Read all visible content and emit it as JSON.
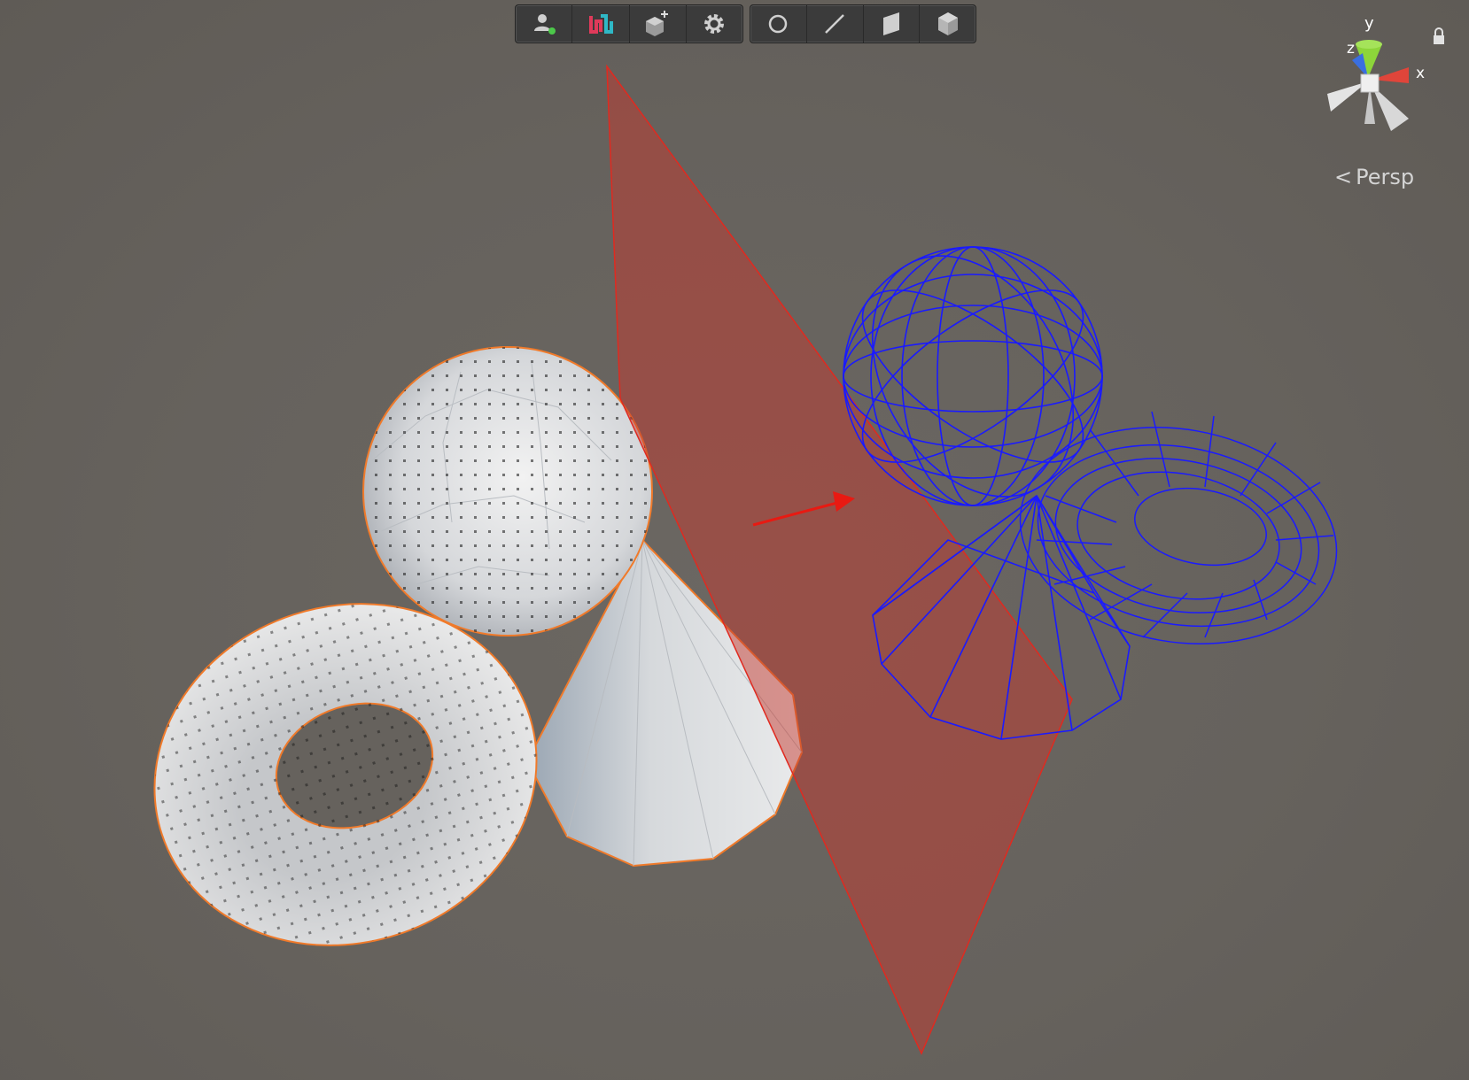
{
  "toolbar_left": {
    "buttons": [
      {
        "icon": "user-presence-icon"
      },
      {
        "icon": "probuilder-logo-icon"
      },
      {
        "icon": "new-shape-icon"
      },
      {
        "icon": "settings-gear-icon"
      }
    ]
  },
  "toolbar_right": {
    "buttons": [
      {
        "icon": "vertex-select-icon"
      },
      {
        "icon": "edge-select-icon"
      },
      {
        "icon": "face-select-icon"
      },
      {
        "icon": "object-select-icon"
      }
    ]
  },
  "gizmo": {
    "axis_y": "y",
    "axis_z": "z",
    "axis_x": "x",
    "colors": {
      "x": "#e0453a",
      "y": "#8dd53a",
      "z": "#3a6fe0"
    }
  },
  "projection": {
    "label": "Persp"
  },
  "scene": {
    "slice_plane_color": "#c4392f",
    "wireframe_color": "#1a1aff",
    "selection_outline_color": "#f07a2a"
  }
}
